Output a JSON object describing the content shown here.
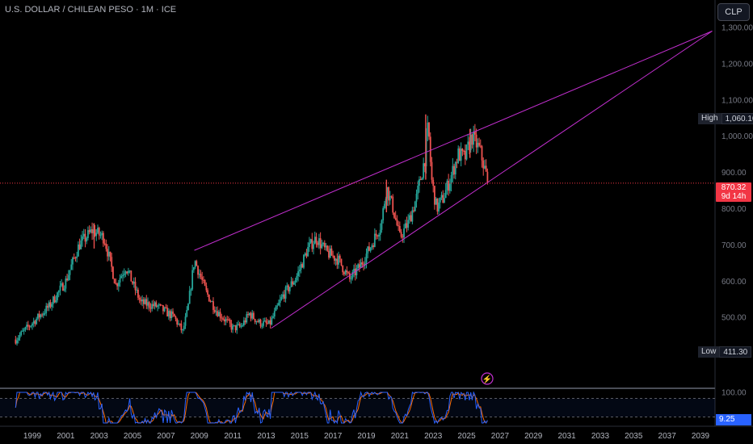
{
  "title": "U.S. DOLLAR / CHILEAN PESO · 1M · ICE",
  "currency_button": "CLP",
  "high_marker": {
    "label": "High",
    "value": "1,060.10"
  },
  "low_marker": {
    "label": "Low",
    "value": "411.30"
  },
  "last_price": {
    "value": "870.32",
    "countdown": "9d 14h"
  },
  "rsi_panel": {
    "value": "9.25",
    "levels": [
      "100.00"
    ]
  },
  "colors": {
    "up": "#26a69a",
    "down": "#ef5350",
    "trendline": "#c42fd1",
    "last_price_line": "#f23645",
    "rsi_k": "#2962ff",
    "rsi_d": "#ff6d00"
  },
  "icons": {
    "alert": "lightning-icon"
  },
  "chart_data": {
    "type": "candlestick",
    "title": "U.S. DOLLAR / CHILEAN PESO · 1M · ICE",
    "xlabel": "",
    "ylabel": "",
    "x_range": [
      1998,
      2040
    ],
    "ylim": [
      400,
      1320
    ],
    "y_ticks": [
      500,
      600,
      700,
      800,
      900,
      1000,
      1100,
      1200,
      1300
    ],
    "y_tick_labels": [
      "500.00",
      "600.00",
      "700.00",
      "800.00",
      "900.00",
      "1,000.00",
      "1,100.00",
      "1,200.00",
      "1,300.00"
    ],
    "x_ticks": [
      1999,
      2001,
      2003,
      2005,
      2007,
      2009,
      2011,
      2013,
      2015,
      2017,
      2019,
      2021,
      2023,
      2025,
      2027,
      2029,
      2031,
      2033,
      2035,
      2037,
      2039
    ],
    "price_path": [
      {
        "x": 1998.0,
        "y": 439
      },
      {
        "x": 1999.0,
        "y": 485
      },
      {
        "x": 2000.0,
        "y": 530
      },
      {
        "x": 2001.0,
        "y": 600
      },
      {
        "x": 2001.8,
        "y": 700
      },
      {
        "x": 2002.6,
        "y": 740
      },
      {
        "x": 2003.3,
        "y": 720
      },
      {
        "x": 2004.0,
        "y": 590
      },
      {
        "x": 2004.6,
        "y": 640
      },
      {
        "x": 2005.5,
        "y": 540
      },
      {
        "x": 2006.5,
        "y": 530
      },
      {
        "x": 2007.5,
        "y": 500
      },
      {
        "x": 2008.0,
        "y": 460
      },
      {
        "x": 2008.3,
        "y": 520
      },
      {
        "x": 2008.7,
        "y": 660
      },
      {
        "x": 2009.4,
        "y": 570
      },
      {
        "x": 2010.0,
        "y": 520
      },
      {
        "x": 2010.6,
        "y": 490
      },
      {
        "x": 2011.0,
        "y": 470
      },
      {
        "x": 2011.5,
        "y": 475
      },
      {
        "x": 2012.0,
        "y": 510
      },
      {
        "x": 2012.6,
        "y": 485
      },
      {
        "x": 2013.2,
        "y": 480
      },
      {
        "x": 2014.0,
        "y": 560
      },
      {
        "x": 2014.8,
        "y": 610
      },
      {
        "x": 2015.5,
        "y": 690
      },
      {
        "x": 2016.0,
        "y": 720
      },
      {
        "x": 2016.6,
        "y": 680
      },
      {
        "x": 2017.3,
        "y": 660
      },
      {
        "x": 2018.0,
        "y": 605
      },
      {
        "x": 2018.6,
        "y": 640
      },
      {
        "x": 2019.3,
        "y": 700
      },
      {
        "x": 2019.9,
        "y": 760
      },
      {
        "x": 2020.2,
        "y": 860
      },
      {
        "x": 2020.6,
        "y": 800
      },
      {
        "x": 2021.0,
        "y": 720
      },
      {
        "x": 2021.5,
        "y": 760
      },
      {
        "x": 2022.0,
        "y": 830
      },
      {
        "x": 2022.5,
        "y": 940
      },
      {
        "x": 2022.7,
        "y": 1030
      },
      {
        "x": 2022.9,
        "y": 880
      },
      {
        "x": 2023.2,
        "y": 800
      },
      {
        "x": 2023.6,
        "y": 830
      },
      {
        "x": 2024.0,
        "y": 880
      },
      {
        "x": 2024.5,
        "y": 950
      },
      {
        "x": 2024.9,
        "y": 940
      },
      {
        "x": 2025.3,
        "y": 1000
      },
      {
        "x": 2025.8,
        "y": 960
      },
      {
        "x": 2026.3,
        "y": 870.32
      }
    ],
    "spikes": [
      {
        "x": 2022.55,
        "low": 880,
        "high": 1060.1
      },
      {
        "x": 2025.2,
        "low": 940,
        "high": 1020
      },
      {
        "x": 2002.7,
        "low": 690,
        "high": 760
      },
      {
        "x": 2020.2,
        "low": 790,
        "high": 880
      }
    ],
    "high": 1060.1,
    "low": 411.3,
    "last": 870.32,
    "trendlines": [
      {
        "from": {
          "x": 2008.7,
          "y": 685
        },
        "to": {
          "x": 2039.7,
          "y": 1290
        }
      },
      {
        "from": {
          "x": 2013.3,
          "y": 470
        },
        "to": {
          "x": 2039.7,
          "y": 1290
        }
      }
    ],
    "rsi": {
      "ylim": [
        0,
        100
      ],
      "levels": [
        80,
        20
      ],
      "last": 9.25
    }
  }
}
